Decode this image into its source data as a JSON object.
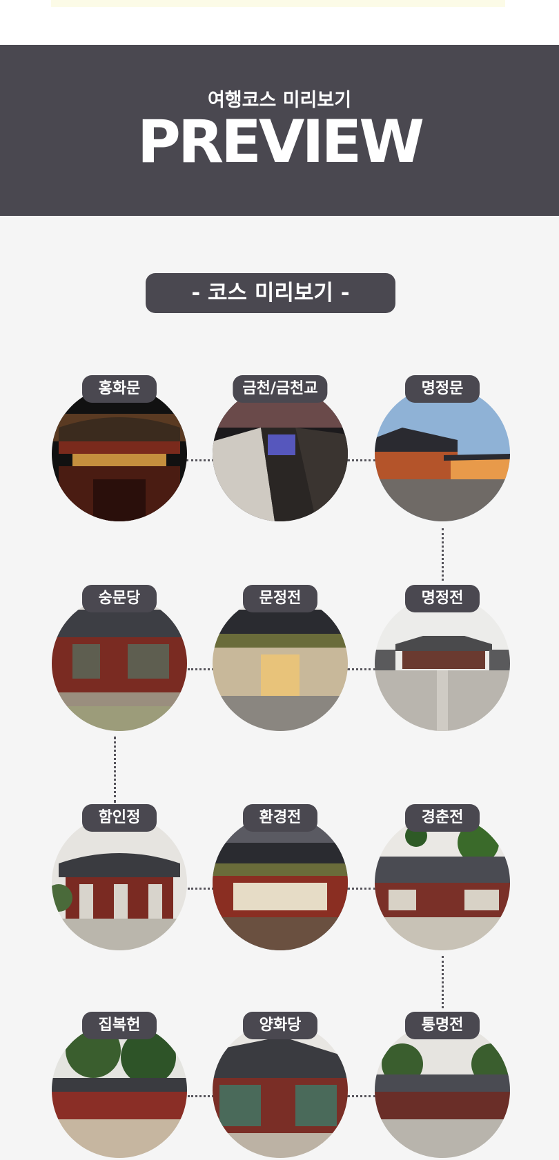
{
  "header": {
    "subtitle": "여행코스 미리보기",
    "title": "PREVIEW"
  },
  "course_pill": {
    "label": "- 코스 미리보기 -"
  },
  "stops": [
    {
      "label": "홍화문"
    },
    {
      "label": "금천/금천교"
    },
    {
      "label": "명정문"
    },
    {
      "label": "숭문당"
    },
    {
      "label": "문정전"
    },
    {
      "label": "명정전"
    },
    {
      "label": "함인정"
    },
    {
      "label": "환경전"
    },
    {
      "label": "경춘전"
    },
    {
      "label": "집복헌"
    },
    {
      "label": "양화당"
    },
    {
      "label": "통명전"
    }
  ],
  "colors": {
    "header_bg": "#4a4850",
    "label_bg": "#4a4850",
    "page_bg": "#f5f5f5",
    "top_bar": "#fcfbe7"
  }
}
